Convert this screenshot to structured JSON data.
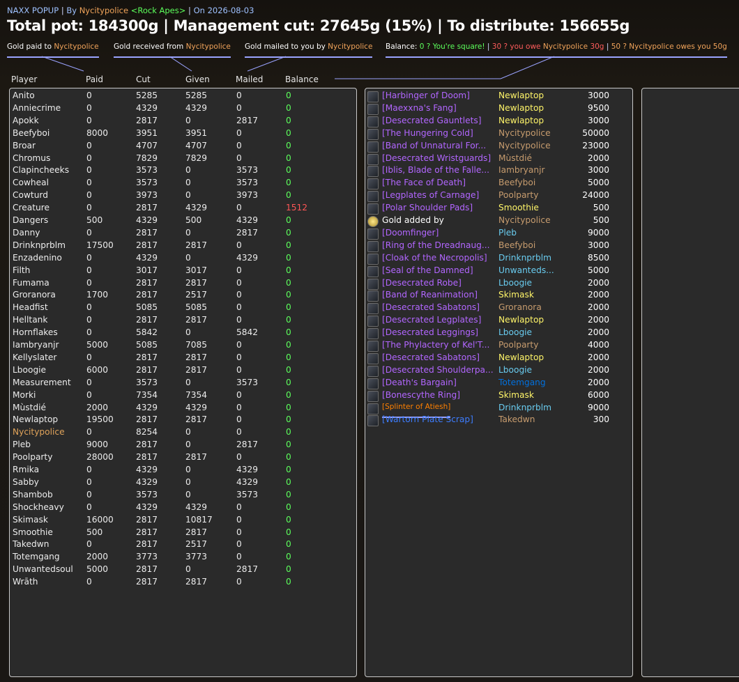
{
  "header": {
    "addon": "NAXX POPUP",
    "by_label": "By",
    "author": "Nycitypolice",
    "guild": "<Rock Apes>",
    "on_label": "On",
    "date": "2026-08-03",
    "sep": "|",
    "total_line": "Total pot: 184300g | Management cut: 27645g (15%) | To distribute: 156655g"
  },
  "legend": {
    "paid_prefix": "Gold paid to",
    "paid_name": "Nycitypolice",
    "received_prefix": "Gold received from",
    "received_name": "Nycitypolice",
    "mailed_prefix": "Gold mailed to you by",
    "mailed_name": "Nycitypolice",
    "balance_prefix": "Balance:",
    "balance_square": "0 ? You're square!",
    "balance_owe_a": "30 ? you owe",
    "balance_owe_name": "Nycitypolice",
    "balance_owe_b": "30g",
    "balance_owed_a": "50 ? Nycitypolice owes you 50g"
  },
  "columns": [
    "Player",
    "Paid",
    "Cut",
    "Given",
    "Mailed",
    "Balance"
  ],
  "players": [
    [
      "Anito",
      "0",
      "5285",
      "5285",
      "0",
      "0"
    ],
    [
      "Anniecrime",
      "0",
      "4329",
      "4329",
      "0",
      "0"
    ],
    [
      "Apokk",
      "0",
      "2817",
      "0",
      "2817",
      "0"
    ],
    [
      "Beefyboi",
      "8000",
      "3951",
      "3951",
      "0",
      "0"
    ],
    [
      "Broar",
      "0",
      "4707",
      "4707",
      "0",
      "0"
    ],
    [
      "Chromus",
      "0",
      "7829",
      "7829",
      "0",
      "0"
    ],
    [
      "Clapincheeks",
      "0",
      "3573",
      "0",
      "3573",
      "0"
    ],
    [
      "Cowheal",
      "0",
      "3573",
      "0",
      "3573",
      "0"
    ],
    [
      "Cowturd",
      "0",
      "3973",
      "0",
      "3973",
      "0"
    ],
    [
      "Creature",
      "0",
      "2817",
      "4329",
      "0",
      "1512"
    ],
    [
      "Dangers",
      "500",
      "4329",
      "500",
      "4329",
      "0"
    ],
    [
      "Danny",
      "0",
      "2817",
      "0",
      "2817",
      "0"
    ],
    [
      "Drinknprblm",
      "17500",
      "2817",
      "2817",
      "0",
      "0"
    ],
    [
      "Enzadenino",
      "0",
      "4329",
      "0",
      "4329",
      "0"
    ],
    [
      "Filth",
      "0",
      "3017",
      "3017",
      "0",
      "0"
    ],
    [
      "Fumama",
      "0",
      "2817",
      "2817",
      "0",
      "0"
    ],
    [
      "Groranora",
      "1700",
      "2817",
      "2517",
      "0",
      "0"
    ],
    [
      "Headfist",
      "0",
      "5085",
      "5085",
      "0",
      "0"
    ],
    [
      "Helltank",
      "0",
      "2817",
      "2817",
      "0",
      "0"
    ],
    [
      "Hornflakes",
      "0",
      "5842",
      "0",
      "5842",
      "0"
    ],
    [
      "Iambryanjr",
      "5000",
      "5085",
      "7085",
      "0",
      "0"
    ],
    [
      "Kellyslater",
      "0",
      "2817",
      "2817",
      "0",
      "0"
    ],
    [
      "Lboogie",
      "6000",
      "2817",
      "2817",
      "0",
      "0"
    ],
    [
      "Measurement",
      "0",
      "3573",
      "0",
      "3573",
      "0"
    ],
    [
      "Morki",
      "0",
      "7354",
      "7354",
      "0",
      "0"
    ],
    [
      "Mùstdié",
      "2000",
      "4329",
      "4329",
      "0",
      "0"
    ],
    [
      "Newlaptop",
      "19500",
      "2817",
      "2817",
      "0",
      "0"
    ],
    [
      "Nycitypolice",
      "0",
      "8254",
      "0",
      "0",
      "0"
    ],
    [
      "Pleb",
      "9000",
      "2817",
      "0",
      "2817",
      "0"
    ],
    [
      "Poolparty",
      "28000",
      "2817",
      "2817",
      "0",
      "0"
    ],
    [
      "Rmika",
      "0",
      "4329",
      "0",
      "4329",
      "0"
    ],
    [
      "Sabby",
      "0",
      "4329",
      "0",
      "4329",
      "0"
    ],
    [
      "Shambob",
      "0",
      "3573",
      "0",
      "3573",
      "0"
    ],
    [
      "Shockheavy",
      "0",
      "4329",
      "4329",
      "0",
      "0"
    ],
    [
      "Skimask",
      "16000",
      "2817",
      "10817",
      "0",
      "0"
    ],
    [
      "Smoothie",
      "500",
      "2817",
      "2817",
      "0",
      "0"
    ],
    [
      "Takedwn",
      "0",
      "2817",
      "2517",
      "0",
      "0"
    ],
    [
      "Totemgang",
      "2000",
      "3773",
      "3773",
      "0",
      "0"
    ],
    [
      "Unwantedsoul",
      "5000",
      "2817",
      "0",
      "2817",
      "0"
    ],
    [
      "Wrāth",
      "0",
      "2817",
      "2817",
      "0",
      "0"
    ]
  ],
  "items": [
    [
      "[Harbinger of Doom]",
      "Newlaptop",
      "3000",
      "epic",
      "cls-rogue"
    ],
    [
      "[Maexxna's Fang]",
      "Newlaptop",
      "9500",
      "epic",
      "cls-rogue"
    ],
    [
      "[Desecrated Gauntlets]",
      "Newlaptop",
      "3000",
      "epic",
      "cls-rogue"
    ],
    [
      "[The Hungering Cold]",
      "Nycitypolice",
      "50000",
      "epic",
      "cls-warrior"
    ],
    [
      "[Band of Unnatural For...",
      "Nycitypolice",
      "23000",
      "epic",
      "cls-warrior"
    ],
    [
      "[Desecrated Wristguards]",
      "Mùstdié",
      "2000",
      "epic",
      "cls-warrior"
    ],
    [
      "[Iblis, Blade of the Falle...",
      "Iambryanjr",
      "3000",
      "epic",
      "cls-warrior"
    ],
    [
      "[The Face of Death]",
      "Beefyboi",
      "5000",
      "epic",
      "cls-warrior"
    ],
    [
      "[Legplates of Carnage]",
      "Poolparty",
      "24000",
      "epic",
      "cls-warrior"
    ],
    [
      "[Polar Shoulder Pads]",
      "Smoothie",
      "500",
      "epic",
      "cls-rogue"
    ],
    [
      "Gold added by",
      "Nycitypolice",
      "500",
      "plain",
      "cls-warrior"
    ],
    [
      "[Doomfinger]",
      "Pleb",
      "9000",
      "epic",
      "cls-mage"
    ],
    [
      "[Ring of the Dreadnaug...",
      "Beefyboi",
      "3000",
      "epic",
      "cls-warrior"
    ],
    [
      "[Cloak of the Necropolis]",
      "Drinknprblm",
      "8500",
      "epic",
      "cls-mage"
    ],
    [
      "[Seal of the Damned]",
      "Unwanteds...",
      "5000",
      "epic",
      "cls-mage"
    ],
    [
      "[Desecrated Robe]",
      "Lboogie",
      "2000",
      "epic",
      "cls-mage"
    ],
    [
      "[Band of Reanimation]",
      "Skimask",
      "2000",
      "epic",
      "cls-rogue"
    ],
    [
      "[Desecrated Sabatons]",
      "Groranora",
      "2000",
      "epic",
      "cls-warrior"
    ],
    [
      "[Desecrated Legplates]",
      "Newlaptop",
      "2000",
      "epic",
      "cls-rogue"
    ],
    [
      "[Desecrated Leggings]",
      "Lboogie",
      "2000",
      "epic",
      "cls-mage"
    ],
    [
      "[The Phylactery of Kel'T...",
      "Poolparty",
      "4000",
      "epic",
      "cls-warrior"
    ],
    [
      "[Desecrated Sabatons]",
      "Newlaptop",
      "2000",
      "epic",
      "cls-rogue"
    ],
    [
      "[Desecrated Shoulderpa...",
      "Lboogie",
      "2000",
      "epic",
      "cls-mage"
    ],
    [
      "[Death's Bargain]",
      "Totemgang",
      "2000",
      "epic",
      "cls-shaman"
    ],
    [
      "[Bonescythe Ring]",
      "Skimask",
      "6000",
      "epic",
      "cls-rogue"
    ],
    [
      "[Splinter of Atiesh]",
      "Drinknprblm",
      "9000",
      "legend",
      "cls-mage"
    ],
    [
      "[Wartorn Plate Scrap]",
      "Takedwn",
      "300",
      "rare",
      "cls-warrior"
    ]
  ]
}
